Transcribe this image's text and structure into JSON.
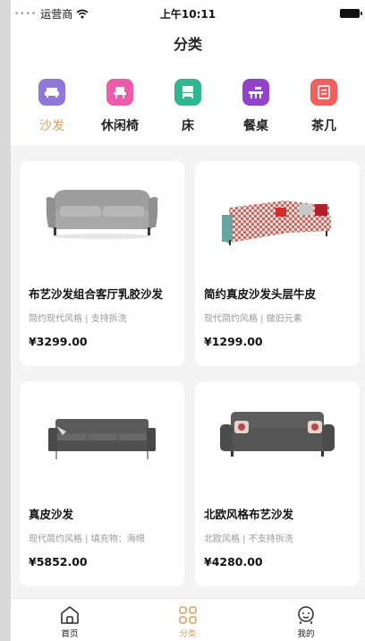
{
  "status": {
    "carrier": "运营商",
    "time": "上午10:11"
  },
  "page": {
    "title": "分类"
  },
  "categories": [
    {
      "label": "沙发",
      "color": "#8f78d8",
      "icon": "sofa-icon",
      "active": true
    },
    {
      "label": "休闲椅",
      "color": "#ee5bab",
      "icon": "lounge-chair-icon",
      "active": false
    },
    {
      "label": "床",
      "color": "#2fb78f",
      "icon": "bed-icon",
      "active": false
    },
    {
      "label": "餐桌",
      "color": "#9243c9",
      "icon": "dining-table-icon",
      "active": false
    },
    {
      "label": "茶几",
      "color": "#f25f5c",
      "icon": "tea-table-icon",
      "active": false
    }
  ],
  "products": [
    {
      "title": "布艺沙发组合客厅乳胶沙发",
      "subtitle": "简约现代风格 | 支持拆洗",
      "price": "¥3299.00",
      "image": "grey-velvet-sofa-image"
    },
    {
      "title": "简约真皮沙发头层牛皮",
      "subtitle": "现代简约风格 | 做旧元素",
      "price": "¥1299.00",
      "image": "pattern-sectional-sofa-image"
    },
    {
      "title": "真皮沙发",
      "subtitle": "现代简约风格 | 填充物：海绵",
      "price": "¥5852.00",
      "image": "dark-grey-sofa-image"
    },
    {
      "title": "北欧风格布艺沙发",
      "subtitle": "北欧风格 | 不支持拆洗",
      "price": "¥4280.00",
      "image": "nordic-fabric-sofa-image"
    }
  ],
  "tabbar": [
    {
      "label": "首页",
      "icon": "home-icon",
      "active": false
    },
    {
      "label": "分类",
      "icon": "category-grid-icon",
      "active": true
    },
    {
      "label": "我的",
      "icon": "profile-icon",
      "active": false
    }
  ],
  "colors": {
    "accent": "#d3a36b",
    "background": "#f4f4f4"
  }
}
